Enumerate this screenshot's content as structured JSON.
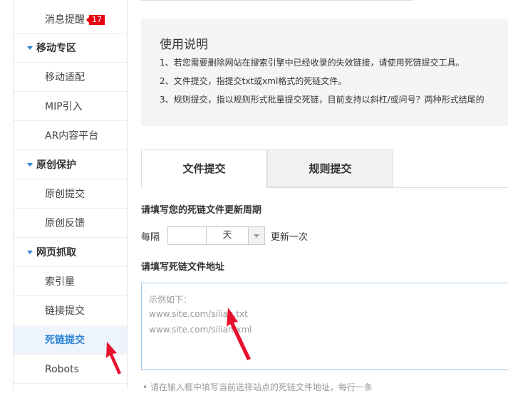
{
  "sidebar": {
    "items": [
      {
        "label": "消息提醒",
        "badge": "17"
      },
      {
        "label": "移动专区"
      },
      {
        "label": "移动适配"
      },
      {
        "label": "MIP引入"
      },
      {
        "label": "AR内容平台"
      },
      {
        "label": "原创保护"
      },
      {
        "label": "原创提交"
      },
      {
        "label": "原创反馈"
      },
      {
        "label": "网页抓取"
      },
      {
        "label": "索引量"
      },
      {
        "label": "链接提交"
      },
      {
        "label": "死链提交"
      },
      {
        "label": "Robots"
      }
    ]
  },
  "usage": {
    "title": "使用说明",
    "lines": [
      "1、若您需要删除网站在搜索引擎中已经收录的失效链接，请使用死链提交工具。",
      "2、文件提交，指提交txt或xml格式的死链文件。",
      "3、规则提交，指以规则形式批量提交死链，目前支持以斜杠/或问号？两种形式结尾的"
    ]
  },
  "tabs": [
    {
      "label": "文件提交",
      "active": true
    },
    {
      "label": "规则提交",
      "active": false
    }
  ],
  "form": {
    "period_heading": "请填写您的死链文件更新周期",
    "every_label": "每隔",
    "period_value": "",
    "period_unit": "天",
    "update_label": "更新一次",
    "address_heading": "请填写死链文件地址",
    "placeholder_lines": [
      "示例如下：",
      "www.site.com/silian.txt",
      "www.site.com/silian.xml"
    ],
    "bottom_note": "• 请在输入框中填写当前选择站点的死链文件地址，每行一条"
  },
  "colors": {
    "accent": "#2a83d8",
    "badge": "#e60012",
    "annotation_arrow": "#e8112d"
  }
}
